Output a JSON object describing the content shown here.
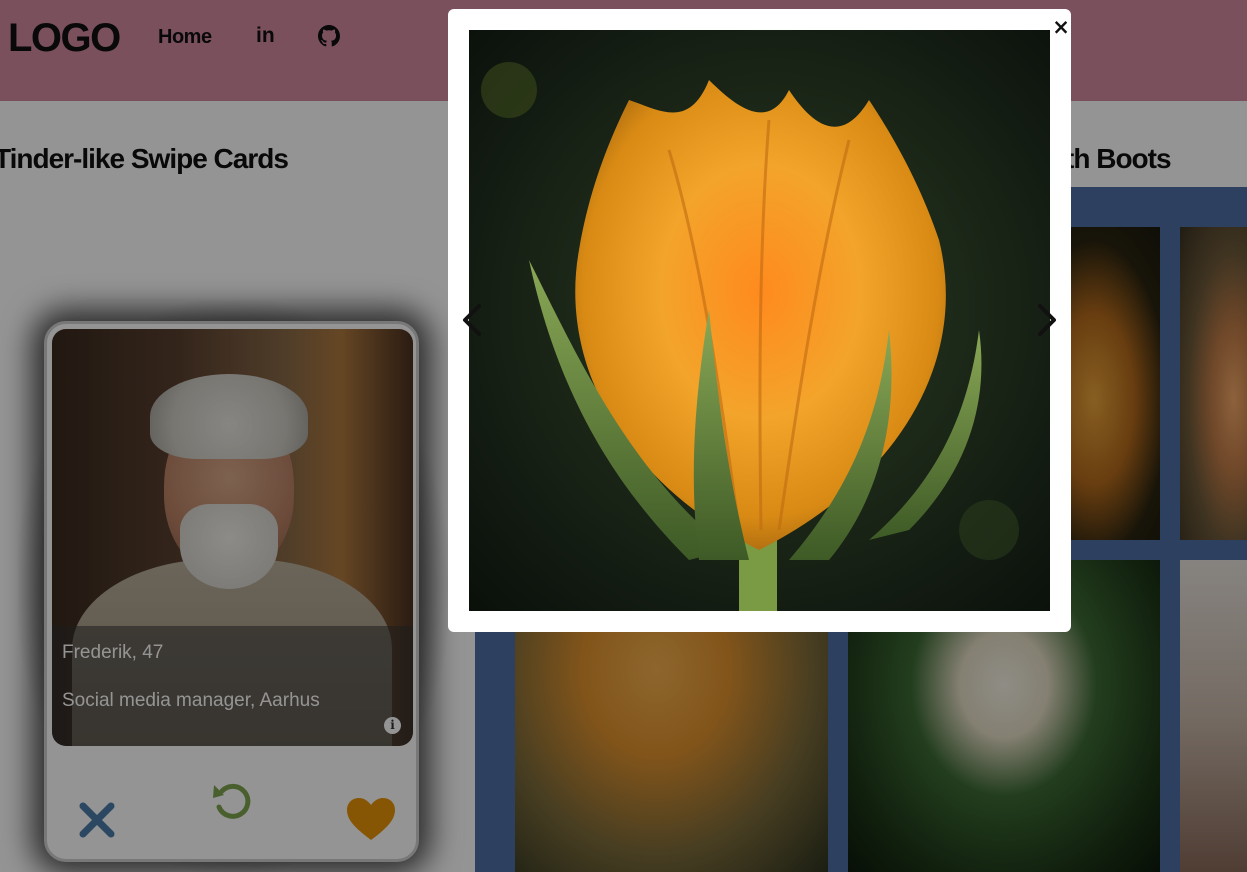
{
  "header": {
    "logo": "LOGO",
    "nav": {
      "home_label": "Home",
      "linkedin_label": "in",
      "linkedin_icon": "linkedin-icon",
      "github_icon": "github-icon"
    },
    "background_color": "#d38aa0"
  },
  "titles": {
    "left": "Tinder-like Swipe Cards",
    "right": "de with Boots"
  },
  "swipe_card": {
    "name": "Frederik, 47",
    "job": "Social media manager, Aarhus",
    "info_icon": "info-icon",
    "info_glyph": "i",
    "actions": {
      "reject_icon": "close-x-icon",
      "undo_icon": "undo-icon",
      "like_icon": "heart-icon"
    },
    "colors": {
      "reject": "#4a7aa8",
      "undo": "#7fa650",
      "like": "#e8950a"
    }
  },
  "gallery": {
    "background_color": "#4f6ea6",
    "tiles": [
      "zucchini-flower",
      "orange-flower",
      "calendula-flower",
      "gardenia-flower",
      "cherry-branch"
    ]
  },
  "lightbox": {
    "close_glyph": "×",
    "close_icon": "close-icon",
    "prev_icon": "chevron-left-icon",
    "next_icon": "chevron-right-icon",
    "image": "zucchini-flower"
  }
}
